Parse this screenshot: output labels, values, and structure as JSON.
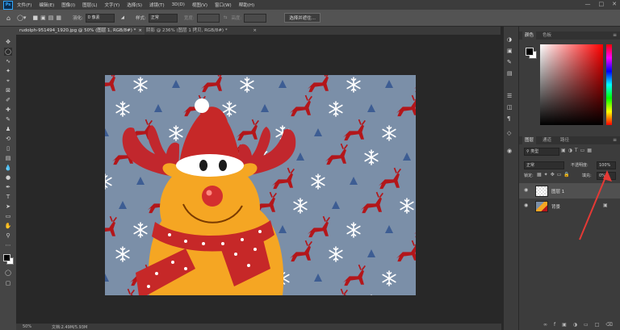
{
  "menu": {
    "app_logo": "Ps",
    "items": [
      "文件(F)",
      "编辑(E)",
      "图像(I)",
      "图层(L)",
      "文字(Y)",
      "选择(S)",
      "滤镜(T)",
      "3D(D)",
      "视图(V)",
      "窗口(W)",
      "帮助(H)"
    ]
  },
  "options": {
    "feather_label": "羽化:",
    "feather_value": "0 像素",
    "style_label": "样式:",
    "style_value": "正常",
    "width_label": "宽度:",
    "height_label": "高度:",
    "select_mask_button": "选择并遮住..."
  },
  "tabs": [
    {
      "label": "rudolph-951494_1920.jpg @ 50% (图层 1, RGB/8#) *"
    },
    {
      "label": "阴影 @ 236% (图层 1 拷贝, RGB/8#) *"
    }
  ],
  "status": {
    "zoom": "50%",
    "doc": "文档:2.49M/5.93M"
  },
  "panels": {
    "color_tab": "颜色",
    "swatches_tab": "色板",
    "layers_tab": "图层",
    "channels_tab": "通道",
    "paths_tab": "路径",
    "kind_filter": "类型",
    "blend_mode": "正常",
    "opacity_label": "不透明度:",
    "opacity_value": "100%",
    "lock_label": "锁定:",
    "fill_label": "填充:",
    "fill_value": "0%",
    "layers": [
      {
        "name": "图层 1"
      },
      {
        "name": "背景"
      }
    ]
  },
  "colors": {
    "background_pattern": "#7b8fa8",
    "reindeer_red": "#b3161a",
    "deer_orange": "#f5a623",
    "annotation_red": "#e53935"
  }
}
